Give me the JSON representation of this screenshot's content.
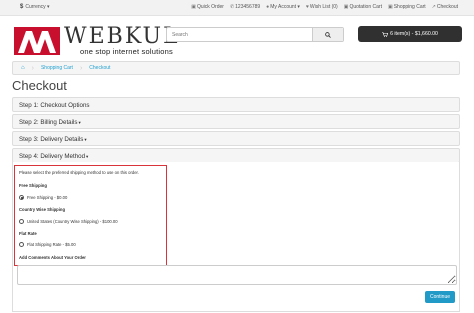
{
  "topbar": {
    "currency_symbol": "$",
    "currency_label": "Currency ▾",
    "links": [
      {
        "icon": "box-icon",
        "glyph": "▣",
        "label": "Quick Order"
      },
      {
        "icon": "phone-icon",
        "glyph": "✆",
        "label": "123456789"
      },
      {
        "icon": "user-icon",
        "glyph": "👤",
        "label": "My Account ▾"
      },
      {
        "icon": "heart-icon",
        "glyph": "♥",
        "label": "Wish List (0)"
      },
      {
        "icon": "quote-cart-icon",
        "glyph": "🛒",
        "label": "Quotation Cart"
      },
      {
        "icon": "cart-icon",
        "glyph": "🛒",
        "label": "Shopping Cart"
      },
      {
        "icon": "share-icon",
        "glyph": "↗",
        "label": "Checkout"
      }
    ]
  },
  "header": {
    "brand": "WEBKUL",
    "tagline": "one stop internet solutions",
    "brand_color": "#c8102e",
    "search": {
      "placeholder": "Search"
    },
    "cart": {
      "label": "6 item(s) - $1,660.00"
    }
  },
  "breadcrumb": {
    "items": [
      "Shopping Cart",
      "Checkout"
    ]
  },
  "page": {
    "title": "Checkout"
  },
  "steps": [
    {
      "label": "Step 1: Checkout Options",
      "caret": ""
    },
    {
      "label": "Step 2: Billing Details",
      "caret": "▾"
    },
    {
      "label": "Step 3: Delivery Details",
      "caret": "▾"
    },
    {
      "label": "Step 4: Delivery Method",
      "caret": "▾"
    }
  ],
  "delivery": {
    "intro": "Please select the preferred shipping method to use on this order.",
    "methods": [
      {
        "heading": "Free Shipping",
        "option": "Free Shipping - $0.00",
        "selected": true
      },
      {
        "heading": "Country Wise Shipping",
        "option": "United States (Country Wise Shipping) - $100.00",
        "selected": false
      },
      {
        "heading": "Flat Rate",
        "option": "Flat Shipping Rate - $5.00",
        "selected": false
      }
    ],
    "comments_label": "Add Comments About Your Order",
    "continue_label": "Continue",
    "highlight_color": "#d9343a",
    "accent_color": "#229ac8"
  }
}
